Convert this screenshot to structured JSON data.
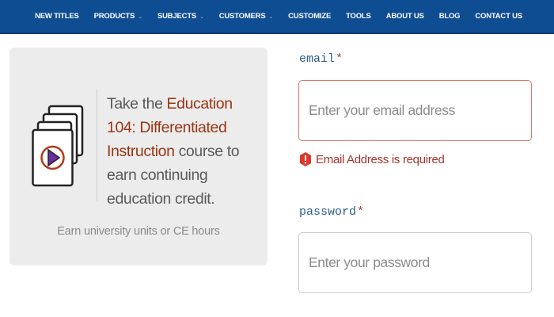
{
  "nav": {
    "items": [
      {
        "label": "NEW TITLES",
        "caret": false
      },
      {
        "label": "PRODUCTS",
        "caret": true
      },
      {
        "label": "SUBJECTS",
        "caret": true
      },
      {
        "label": "CUSTOMERS",
        "caret": true
      },
      {
        "label": "CUSTOMIZE",
        "caret": false
      },
      {
        "label": "TOOLS",
        "caret": false
      },
      {
        "label": "ABOUT US",
        "caret": false
      },
      {
        "label": "BLOG",
        "caret": false
      },
      {
        "label": "CONTACT US",
        "caret": false
      }
    ],
    "caret_glyph": "⌄"
  },
  "course_card": {
    "text_before": "Take the ",
    "course_link": "Education 104: Differentiated Instruction",
    "text_after": " course to earn continuing education credit.",
    "footer": "Earn university units or CE hours",
    "icon": "video-stack-icon"
  },
  "form": {
    "email": {
      "label": "email",
      "required_mark": "*",
      "placeholder": "Enter your email address",
      "value": "",
      "error": "Email Address is required"
    },
    "password": {
      "label": "password",
      "required_mark": "*",
      "placeholder": "Enter your password",
      "value": ""
    }
  },
  "colors": {
    "nav_bg": "#0f4d92",
    "link": "#9a3412",
    "label": "#2f5f8f",
    "error": "#a8322d",
    "error_border": "#d9786a",
    "icon_play": "#6b2fa0",
    "icon_ring": "#b23a1a"
  }
}
